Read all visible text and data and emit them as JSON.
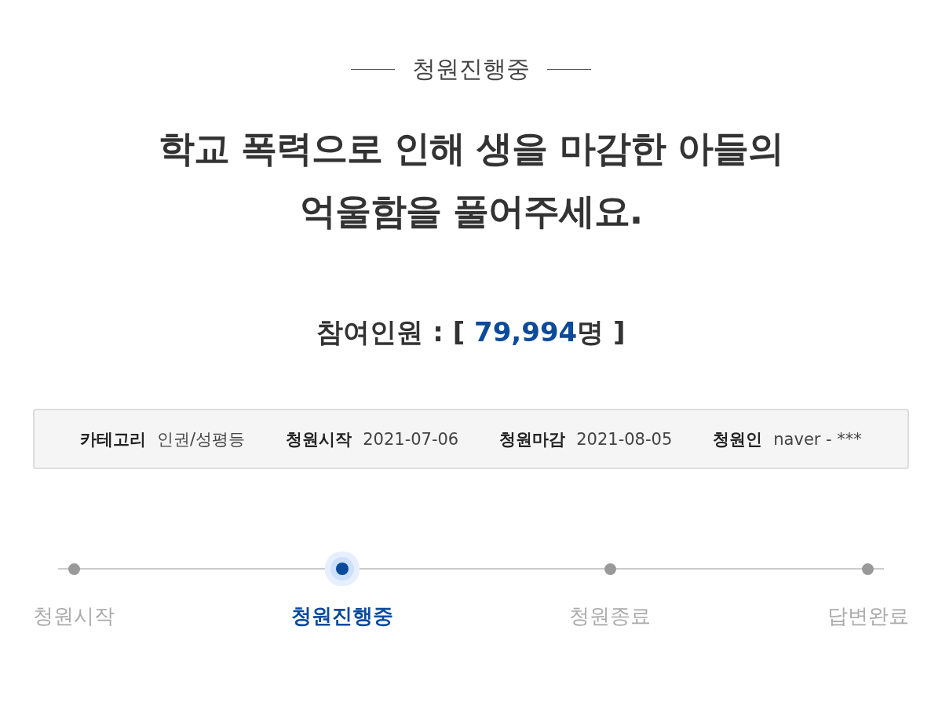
{
  "status_heading": "청원진행중",
  "title_lines": [
    "학교 폭력으로 인해 생을 마감한 아들의",
    "억울함을 풀어주세요."
  ],
  "participants": {
    "label": "참여인원 :",
    "open": "[",
    "value": "79,994",
    "unit": "명",
    "close": "]"
  },
  "info": [
    {
      "label": "카테고리",
      "value": "인권/성평등"
    },
    {
      "label": "청원시작",
      "value": "2021-07-06"
    },
    {
      "label": "청원마감",
      "value": "2021-08-05"
    },
    {
      "label": "청원인",
      "value": "naver - ***"
    }
  ],
  "steps": [
    {
      "label": "청원시작",
      "selected": false
    },
    {
      "label": "청원진행중",
      "selected": true
    },
    {
      "label": "청원종료",
      "selected": false
    },
    {
      "label": "답변완료",
      "selected": false
    }
  ]
}
